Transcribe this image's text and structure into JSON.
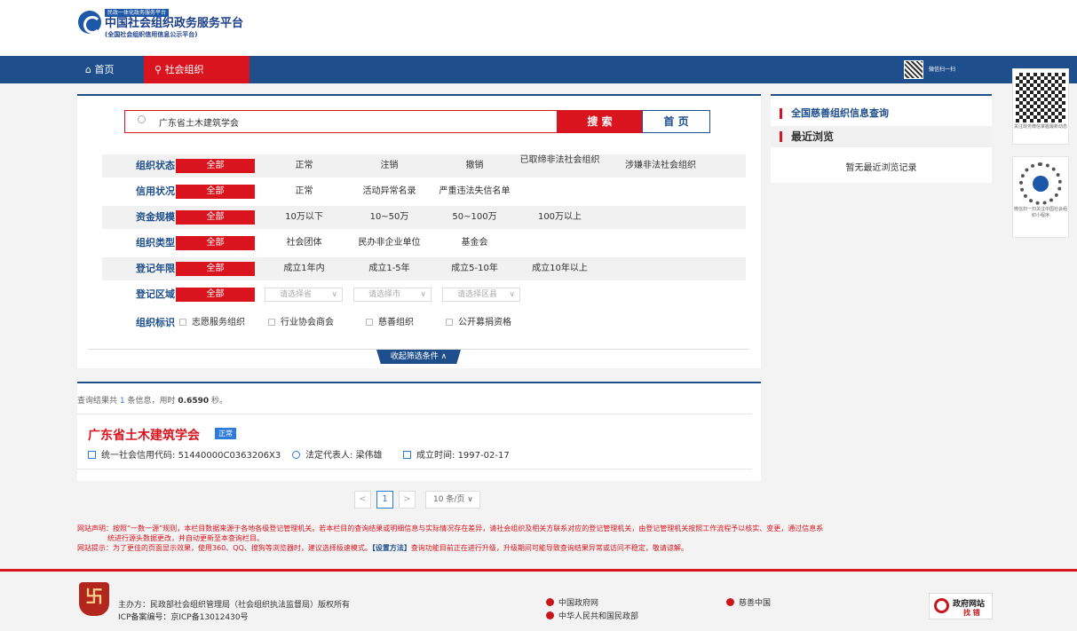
{
  "header": {
    "badge": "民政一体化政务服务平台",
    "title": "中国社会组织政务服务平台",
    "subtitle": "(全国社会组织信用信息公示平台)"
  },
  "nav": {
    "home": "首页",
    "org": "社会组织",
    "wechat": "微信扫一扫"
  },
  "search": {
    "value": "广东省土木建筑学会",
    "button": "搜 索",
    "home_button": "首 页"
  },
  "filters": {
    "all": "全部",
    "status": {
      "label": "组织状态",
      "options": [
        "正常",
        "注销",
        "撤销",
        "已取缔非法社会组织",
        "涉嫌非法社会组织"
      ]
    },
    "credit": {
      "label": "信用状况",
      "options": [
        "正常",
        "活动异常名录",
        "严重违法失信名单"
      ]
    },
    "capital": {
      "label": "资金规模",
      "options": [
        "10万以下",
        "10~50万",
        "50~100万",
        "100万以上"
      ]
    },
    "type": {
      "label": "组织类型",
      "options": [
        "社会团体",
        "民办非企业单位",
        "基金会"
      ]
    },
    "years": {
      "label": "登记年限",
      "options": [
        "成立1年内",
        "成立1-5年",
        "成立5-10年",
        "成立10年以上"
      ]
    },
    "region": {
      "label": "登记区域",
      "province": "请选择省",
      "city": "请选择市",
      "district": "请选择区县"
    },
    "marks": {
      "label": "组织标识",
      "options": [
        "志愿服务组织",
        "行业协会商会",
        "慈善组织",
        "公开募捐资格"
      ]
    },
    "collapse": "收起筛选条件"
  },
  "results": {
    "summary_prefix": "查询结果共",
    "count": "1",
    "summary_mid": "条信息，用时",
    "time": "0.6590",
    "summary_suffix": "秒。",
    "items": [
      {
        "name": "广东省土木建筑学会",
        "status": "正常",
        "code_label": "统一社会信用代码:",
        "code": "51440000C0363206X3",
        "rep_label": "法定代表人:",
        "rep": "梁伟雄",
        "date_label": "成立时间:",
        "date": "1997-02-17"
      }
    ]
  },
  "pager": {
    "prev": "<",
    "current": "1",
    "next": ">",
    "page_size": "10 条/页"
  },
  "sidebar": {
    "charity_link": "全国慈善组织信息查询",
    "recent_title": "最近浏览",
    "recent_empty": "暂无最近浏览记录"
  },
  "qr": {
    "gov_caption": "关注政务微信掌握最新动态",
    "mini_caption": "微信扫一扫关注中国社会组织小程序"
  },
  "notice": {
    "line1": "网站声明：按照“一数一源”规则，本栏目数据来源于各地各级登记管理机关。若本栏目的查询结果或明细信息与实际情况存在差异，请社会组织及相关方联系对应的登记管理机关，由登记管理机关按照工作流程予以核实、变更，通过信息系",
    "line2": "统进行源头数据更改，并自动更新至本查询栏目。",
    "line3_pre": "网站提示：为了更佳的页面显示效果，使用360、QQ、搜狗等浏览器时，建议选择极速模式。",
    "line3_link": "【设置方法】",
    "line3_post": "查询功能目前正在进行升级，升级期间可能导致查询结果异常或访问不稳定，敬请谅解。"
  },
  "footer": {
    "host": "主办方：民政部社会组织管理局（社会组织执法监督局）版权所有",
    "icp": "ICP备案编号：京ICP备13012430号",
    "link_gov": "中国政府网",
    "link_mca": "中华人民共和国民政部",
    "link_charity": "慈善中国",
    "govsite_t1": "政府网站",
    "govsite_t2": "找 错"
  },
  "colors": {
    "primary": "#1e4f8c",
    "accent": "#d9141e",
    "badge": "#2e7bd8"
  }
}
